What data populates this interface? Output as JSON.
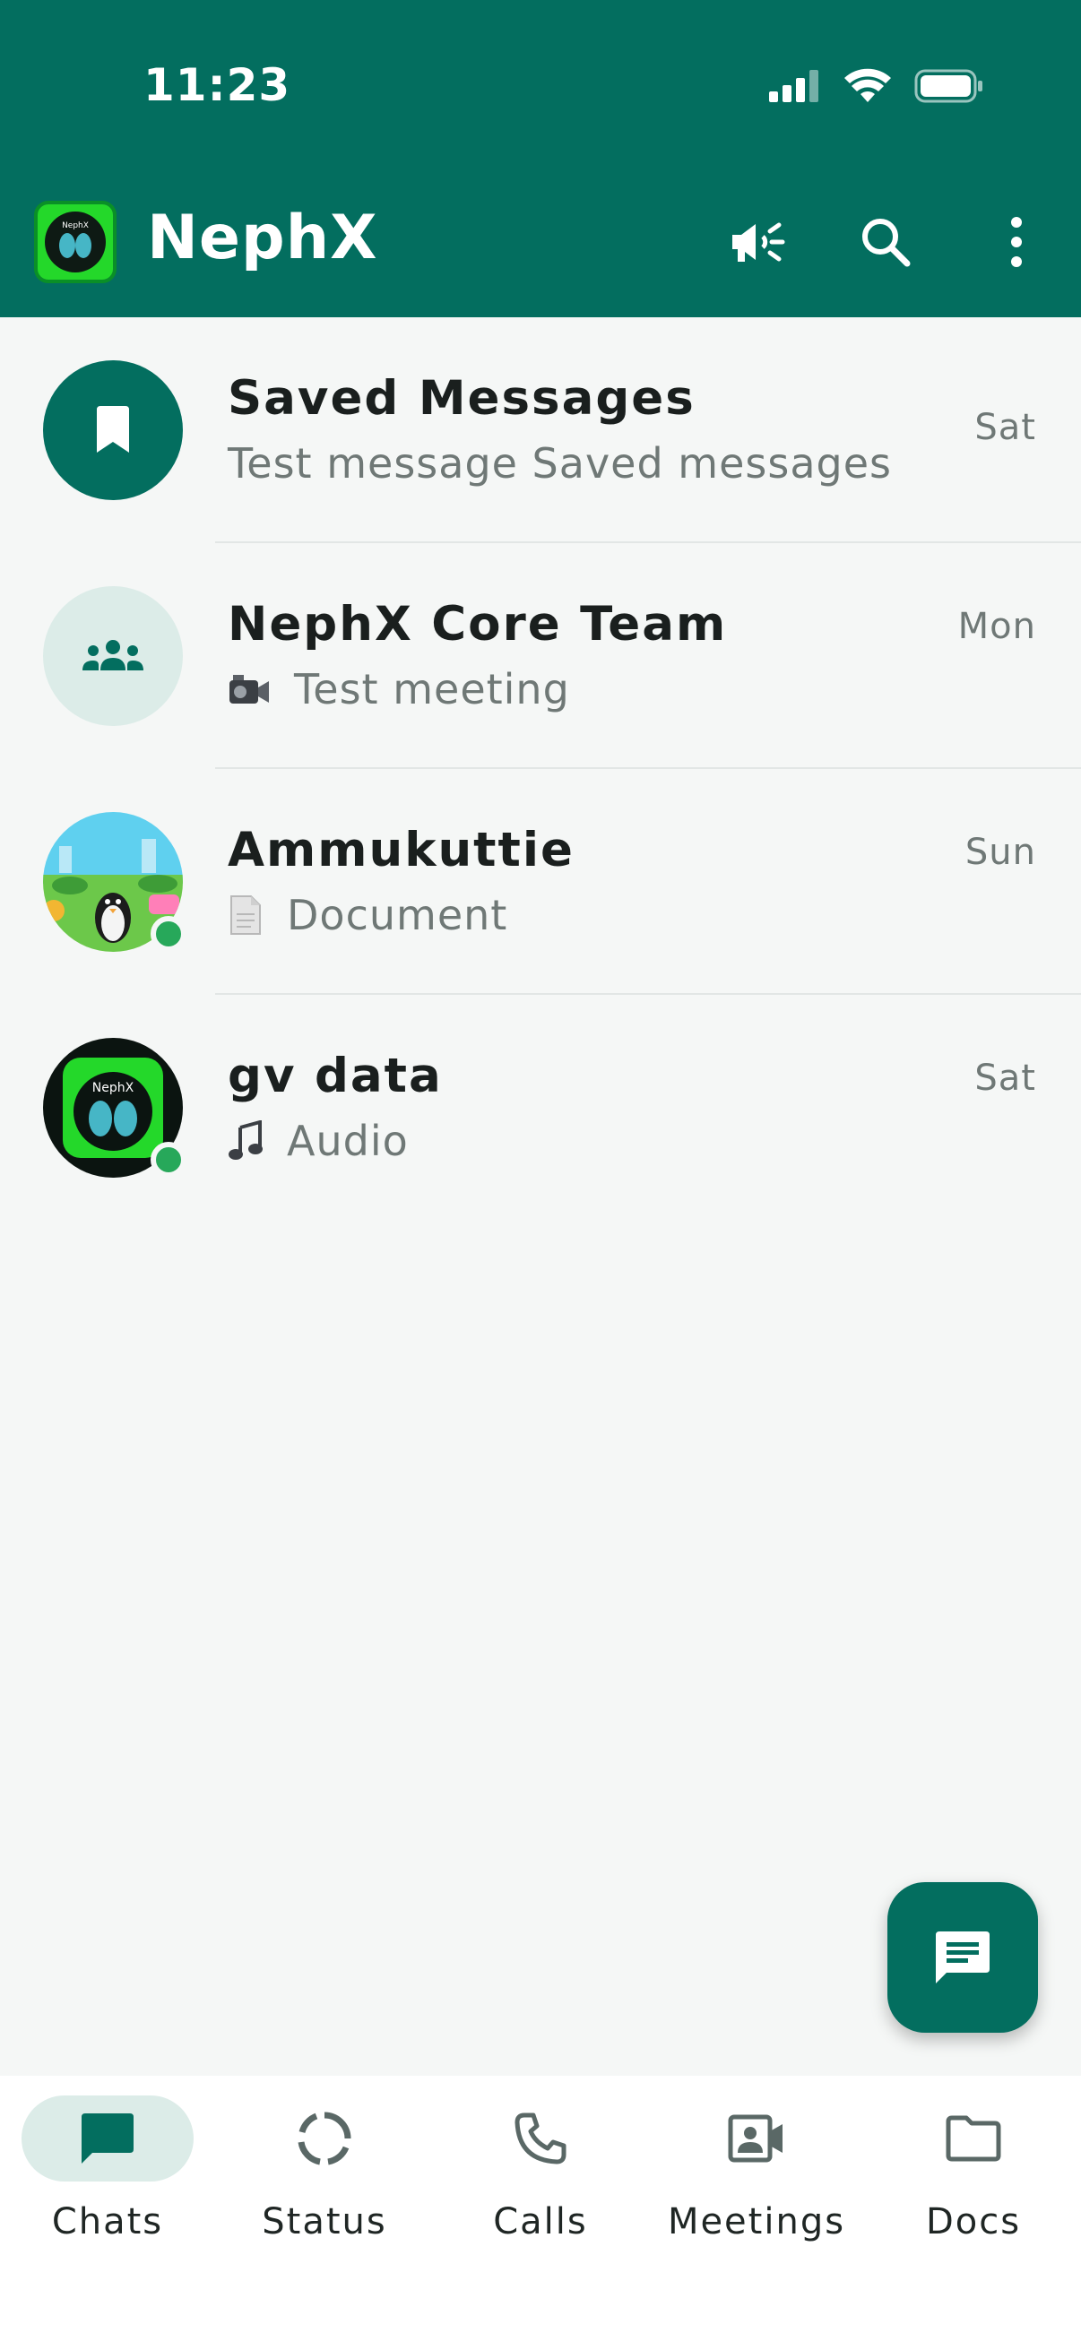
{
  "status_bar": {
    "time": "11:23"
  },
  "app": {
    "title": "NephX"
  },
  "colors": {
    "primary": "#036e5f",
    "online": "#27a85a",
    "nav_active_bg": "#dcece8"
  },
  "header_actions": [
    {
      "icon": "megaphone-icon"
    },
    {
      "icon": "search-icon"
    },
    {
      "icon": "more-vert-icon"
    }
  ],
  "chats": [
    {
      "name": "Saved Messages",
      "preview": "Test message Saved messages",
      "preview_icon": "",
      "time": "Sat",
      "avatar": "bookmark-icon",
      "online": false
    },
    {
      "name": "NephX Core Team",
      "preview": "Test meeting",
      "preview_icon": "video-camera-emoji",
      "time": "Mon",
      "avatar": "group-icon",
      "online": false
    },
    {
      "name": "Ammukuttie",
      "preview": "Document",
      "preview_icon": "document-emoji",
      "time": "Sun",
      "avatar": "penguin-avatar",
      "online": true
    },
    {
      "name": "gv data",
      "preview": "Audio",
      "preview_icon": "music-note-emoji",
      "time": "Sat",
      "avatar": "nephx-logo-avatar",
      "online": true
    }
  ],
  "nav": [
    {
      "label": "Chats",
      "icon": "chat-icon",
      "active": true
    },
    {
      "label": "Status",
      "icon": "status-ring-icon",
      "active": false
    },
    {
      "label": "Calls",
      "icon": "phone-icon",
      "active": false
    },
    {
      "label": "Meetings",
      "icon": "video-contact-icon",
      "active": false
    },
    {
      "label": "Docs",
      "icon": "folder-icon",
      "active": false
    }
  ],
  "logo_text": "NephX"
}
